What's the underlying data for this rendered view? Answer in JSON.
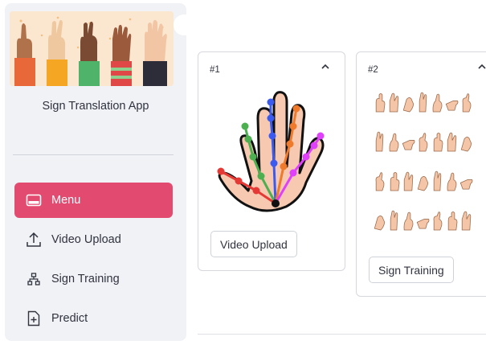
{
  "sidebar": {
    "app_title": "Sign Translation App",
    "menu": [
      {
        "label": "Menu",
        "icon": "menu-window-icon",
        "active": true
      },
      {
        "label": "Video Upload",
        "icon": "upload-icon",
        "active": false
      },
      {
        "label": "Sign Training",
        "icon": "sitemap-icon",
        "active": false
      },
      {
        "label": "Predict",
        "icon": "file-plus-icon",
        "active": false
      }
    ]
  },
  "cards": [
    {
      "index": "#1",
      "button": "Video Upload",
      "chevron": "^"
    },
    {
      "index": "#2",
      "button": "Sign Training",
      "chevron": "^"
    }
  ],
  "colors": {
    "accent": "#e34a6f",
    "sidebar_bg": "#f0f2f6",
    "skin": "#f5c5a8",
    "finger_blue": "#3b5bf0",
    "finger_green": "#4caf50",
    "finger_orange": "#f07a2b",
    "finger_magenta": "#e040fb",
    "finger_red": "#e53935"
  }
}
